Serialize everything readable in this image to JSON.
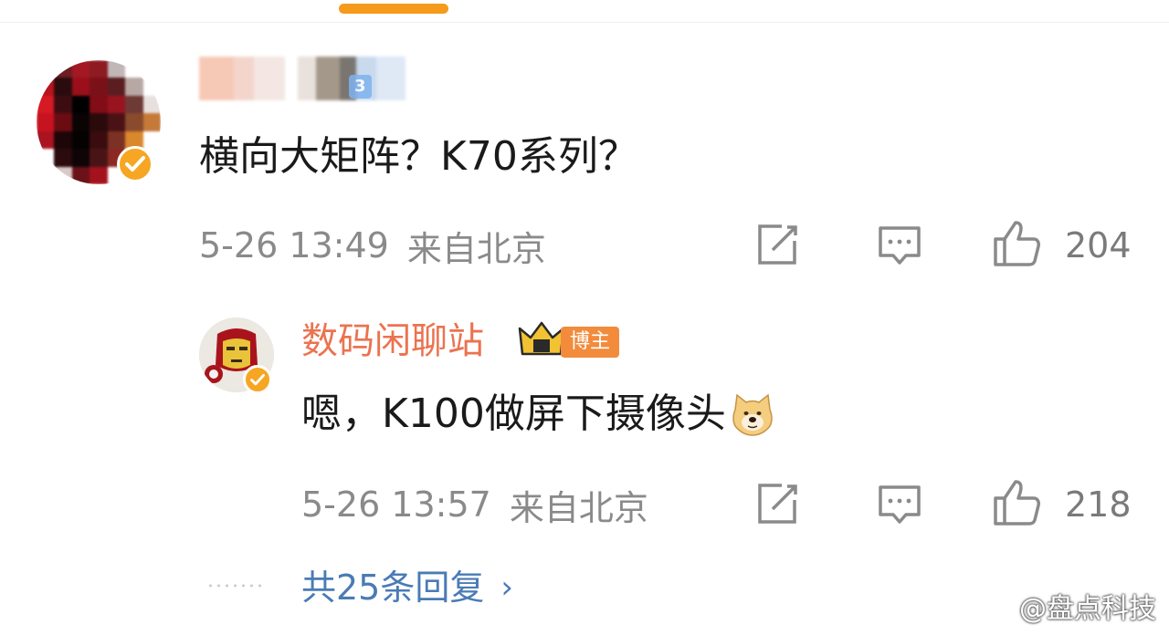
{
  "comment": {
    "author_name": "",
    "author_level_tag": "3",
    "text": "横向大矩阵？K70系列？",
    "time": "5-26 13:49",
    "location": "来自北京",
    "likes": "204"
  },
  "reply": {
    "author_name": "数码闲聊站",
    "badge_label": "博主",
    "crown_level": "III",
    "text": "嗯，K100做屏下摄像头",
    "emoji": "doge",
    "time": "5-26 13:57",
    "location": "来自北京",
    "likes": "218"
  },
  "more_replies": {
    "label": "共25条回复",
    "chevron": "›"
  },
  "watermark": {
    "text": "@盘点科技"
  },
  "colors": {
    "accent_orange": "#f59a1a",
    "username_orange": "#eb7350",
    "link_blue": "#4a7bb5",
    "meta_gray": "#8a8a8a",
    "verified_gold": "#f6a623"
  },
  "icons": {
    "share": "share-icon",
    "comment": "comment-icon",
    "like": "thumbs-up-icon"
  }
}
